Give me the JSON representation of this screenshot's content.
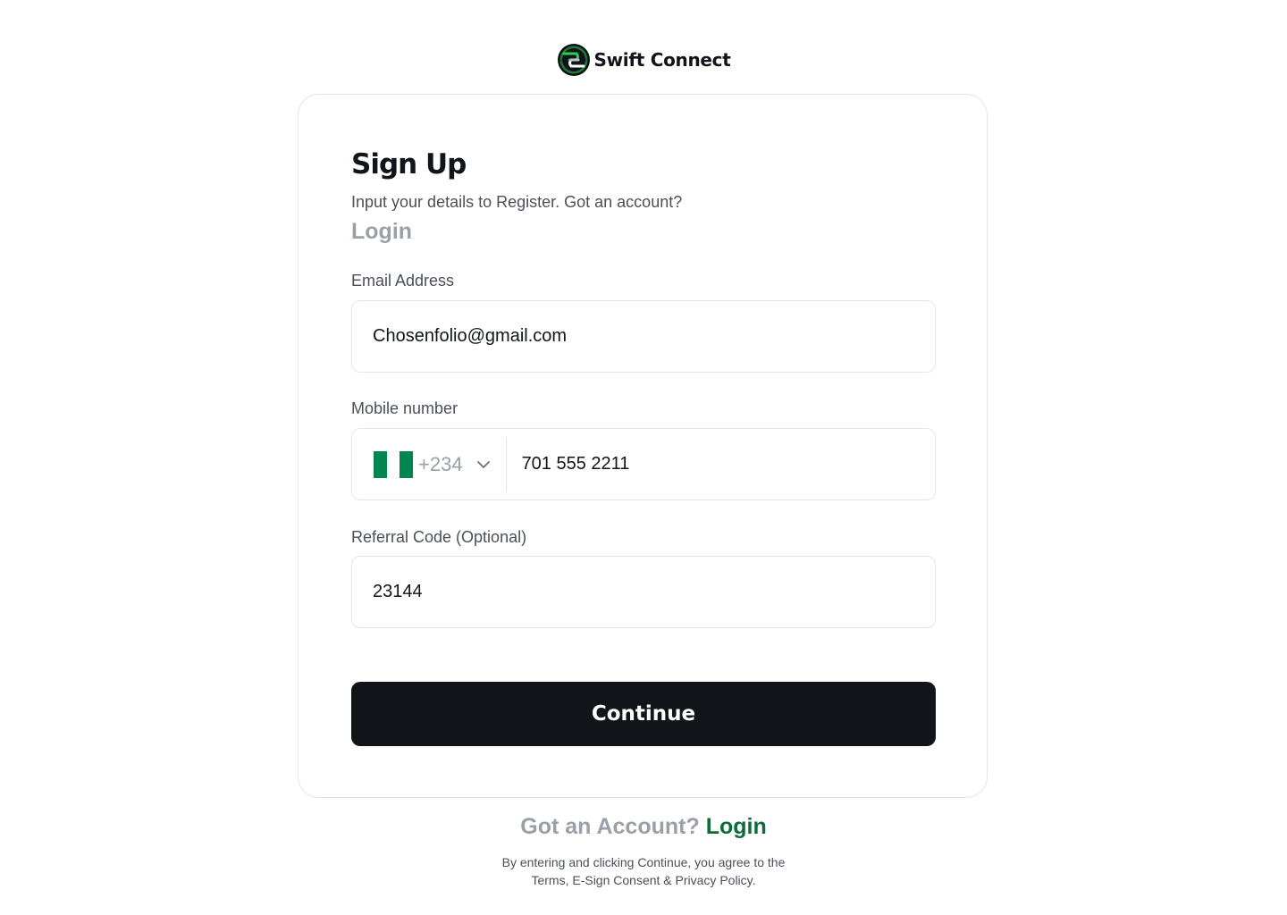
{
  "brand": {
    "name": "Swift Connect",
    "logo_icon": "swift-connect-logo-icon",
    "accent_color": "#1db954"
  },
  "signup": {
    "title": "Sign Up",
    "subtitle": "Input your details to Register. Got an account?",
    "login_link": "Login"
  },
  "form": {
    "email": {
      "label": "Email Address",
      "value": "Chosenfolio@gmail.com"
    },
    "mobile": {
      "label": "Mobile number",
      "country_flag": "nigeria-flag-icon",
      "dial_code": "+234",
      "value": "701 555 2211"
    },
    "referral": {
      "label": "Referral Code (Optional)",
      "value": "23144"
    },
    "submit_label": "Continue"
  },
  "footer": {
    "account_question": "Got an Account?",
    "login_link": "Login",
    "legal_line1": "By entering and clicking Continue, you agree to the",
    "legal_line2": "Terms, E-Sign Consent & Privacy Policy."
  },
  "colors": {
    "primary_button": "#111418",
    "link_green": "#0e6b3a",
    "muted_text": "#9aa0a8",
    "border": "#e3e5e8"
  }
}
